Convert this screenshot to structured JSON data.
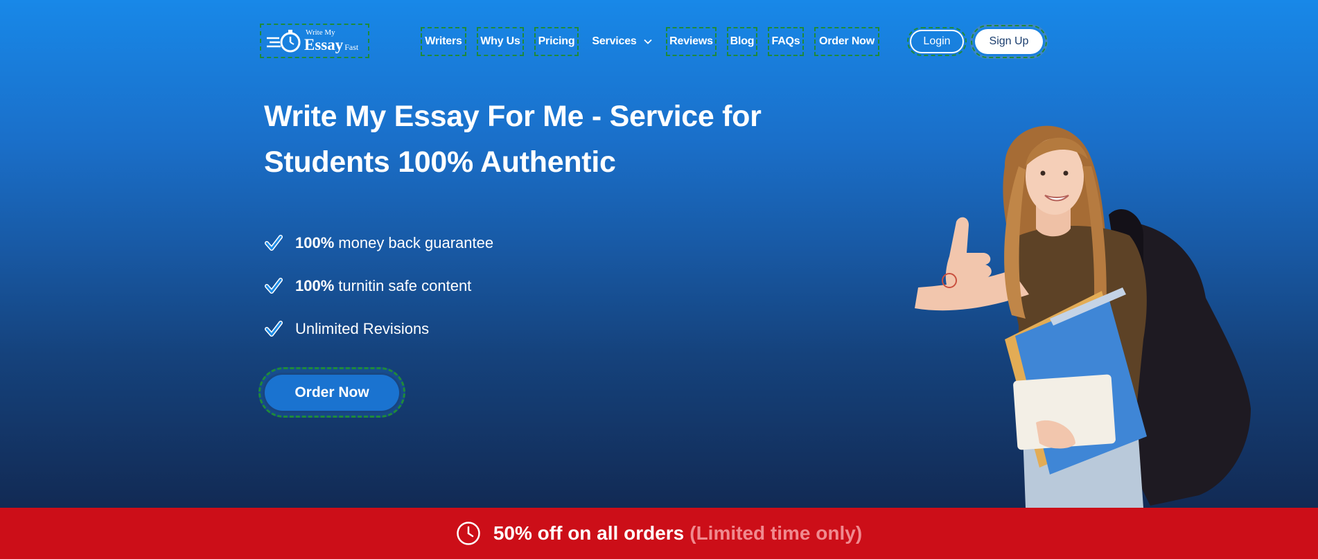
{
  "brand": {
    "line1": "Write My",
    "line2": "Essay",
    "line3": "Fast"
  },
  "nav": {
    "items": [
      {
        "label": "Writers"
      },
      {
        "label": "Why Us"
      },
      {
        "label": "Pricing"
      },
      {
        "label": "Services"
      },
      {
        "label": "Reviews"
      },
      {
        "label": "Blog"
      },
      {
        "label": "FAQs"
      },
      {
        "label": "Order Now"
      }
    ],
    "login": "Login",
    "signup": "Sign Up"
  },
  "hero": {
    "headline_line1": "Write My Essay For Me - Service for",
    "headline_line2": "Students 100% Authentic",
    "features": [
      {
        "bold": "100%",
        "text": "money back guarantee"
      },
      {
        "bold": "100%",
        "text": "turnitin safe content"
      },
      {
        "bold": "",
        "text": "Unlimited Revisions"
      }
    ],
    "cta": "Order Now"
  },
  "promo": {
    "main": "50% off on all orders",
    "sub": "(Limited time only)"
  },
  "colors": {
    "accent": "#1a73d0",
    "promo_bg": "#cc0e18",
    "promo_sub": "#f08a8f"
  },
  "icons": {
    "logo": "stopwatch-pen-icon",
    "feature": "check-icon",
    "services_dropdown": "chevron-down-icon",
    "promo": "clock-icon"
  }
}
